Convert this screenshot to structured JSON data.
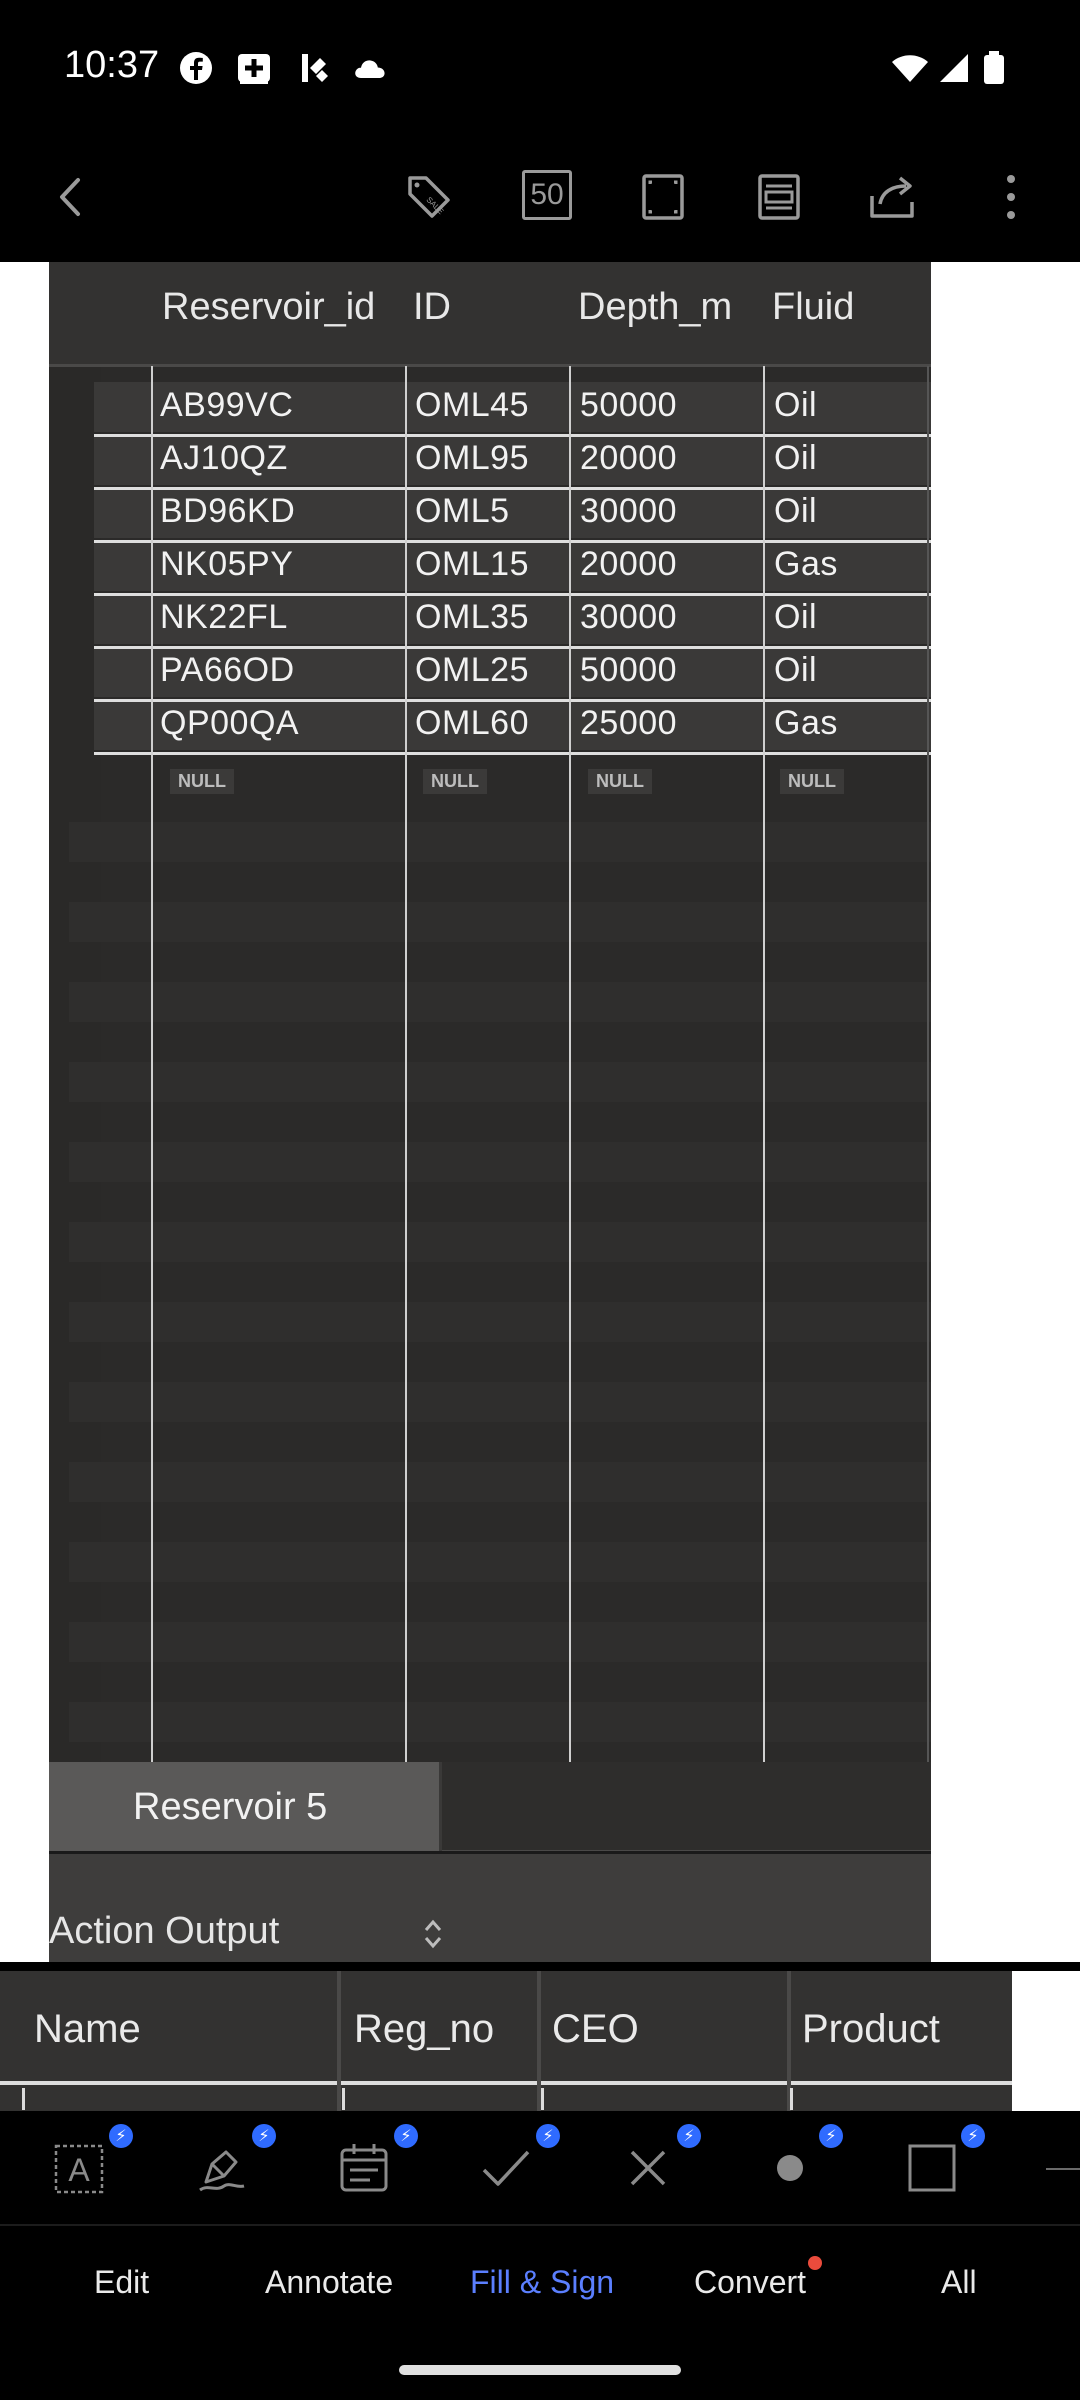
{
  "status_bar": {
    "time": "10:37",
    "left_icons": [
      "facebook-icon",
      "plus-box-icon",
      "kodi-icon",
      "cloud-icon"
    ],
    "right_icons": [
      "wifi-icon",
      "signal-icon",
      "battery-icon"
    ]
  },
  "toolbar": {
    "page_count_badge": "50",
    "icons": [
      "back-icon",
      "sale-tag-icon",
      "page-count-icon",
      "fullscreen-icon",
      "reader-mode-icon",
      "share-icon",
      "more-icon"
    ]
  },
  "table": {
    "columns": [
      "Reservoir_id",
      "ID",
      "Depth_m",
      "Fluid"
    ],
    "rows": [
      [
        "AB99VC",
        "OML45",
        "50000",
        "Oil"
      ],
      [
        "AJ10QZ",
        "OML95",
        "20000",
        "Oil"
      ],
      [
        "BD96KD",
        "OML5",
        "30000",
        "Oil"
      ],
      [
        "NK05PY",
        "OML15",
        "20000",
        "Gas"
      ],
      [
        "NK22FL",
        "OML35",
        "30000",
        "Oil"
      ],
      [
        "PA66OD",
        "OML25",
        "50000",
        "Oil"
      ],
      [
        "QP00QA",
        "OML60",
        "25000",
        "Gas"
      ]
    ],
    "null_row": [
      "NULL",
      "NULL",
      "NULL",
      "NULL"
    ]
  },
  "tab": {
    "label": "Reservoir 5"
  },
  "action_output": {
    "label": "Action Output"
  },
  "table2": {
    "columns": [
      "Name",
      "Reg_no",
      "CEO",
      "Product"
    ]
  },
  "bottom_tools": [
    "text-box-icon",
    "signature-pen-icon",
    "date-icon",
    "checkmark-icon",
    "cross-icon",
    "dot-icon",
    "rectangle-icon"
  ],
  "nav": {
    "items": [
      "Edit",
      "Annotate",
      "Fill & Sign",
      "Convert",
      "All"
    ],
    "active": "Fill & Sign"
  },
  "colors": {
    "accent": "#5b7fff",
    "badge_blue": "#2f6bff",
    "notification": "#ea4b3c"
  }
}
